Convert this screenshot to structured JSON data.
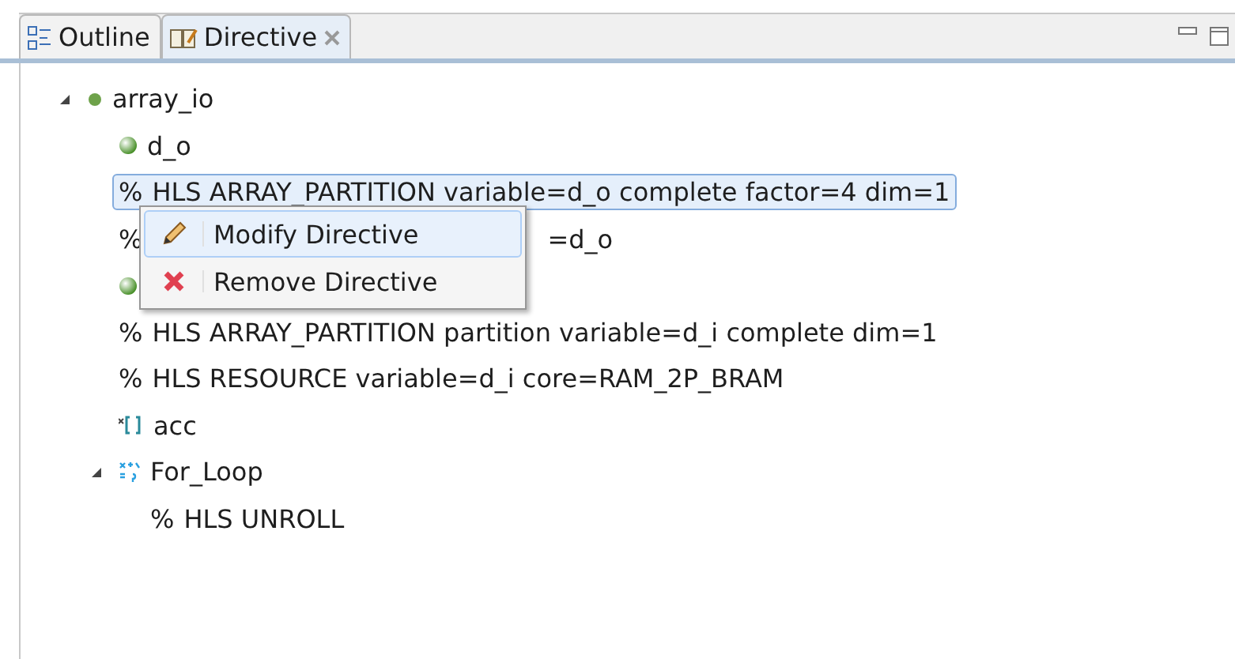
{
  "tabs": [
    {
      "label": "Outline",
      "selected": false,
      "kind": "outline"
    },
    {
      "label": "Directive",
      "selected": true,
      "kind": "directive",
      "closable": true
    }
  ],
  "tree": [
    {
      "kind": "function",
      "label": "array_io",
      "expanded": true,
      "selected": false,
      "children": [
        {
          "kind": "port",
          "label": "d_o",
          "selected": false
        },
        {
          "kind": "directive",
          "prefix": "%",
          "label": "HLS ARRAY_PARTITION variable=d_o complete factor=4 dim=1",
          "selected": true
        },
        {
          "kind": "directive",
          "prefix": "%",
          "tail": "=d_o",
          "selected": false
        },
        {
          "kind": "port",
          "selected": false
        },
        {
          "kind": "directive",
          "prefix": "%",
          "label": "HLS ARRAY_PARTITION partition variable=d_i complete dim=1",
          "selected": false
        },
        {
          "kind": "directive",
          "prefix": "%",
          "label": "HLS RESOURCE variable=d_i core=RAM_2P_BRAM",
          "selected": false
        },
        {
          "kind": "variable",
          "label": "acc",
          "selected": false
        },
        {
          "kind": "loop",
          "label": "For_Loop",
          "expanded": true,
          "selected": false,
          "children": [
            {
              "kind": "directive",
              "prefix": "%",
              "label": "HLS UNROLL",
              "selected": false
            }
          ]
        }
      ]
    }
  ],
  "context_menu": [
    {
      "label": "Modify Directive",
      "kind": "modify",
      "selected": true
    },
    {
      "label": "Remove Directive",
      "kind": "remove",
      "selected": false
    }
  ]
}
